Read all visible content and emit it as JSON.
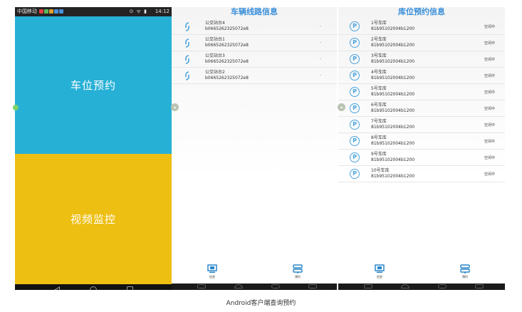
{
  "status_bar": {
    "carrier": "中国移动",
    "time": "14:12"
  },
  "home": {
    "parking_tile_label": "车位预约",
    "video_tile_label": "视频监控"
  },
  "routes_screen": {
    "title": "车辆线路信息",
    "items": [
      {
        "name": "公交站台4",
        "id": "b0665262325072e8",
        "value": "-"
      },
      {
        "name": "公交站台1",
        "id": "b0665262325072e8",
        "value": "-"
      },
      {
        "name": "公交站台3",
        "id": "b0665262325072e8",
        "value": "-"
      },
      {
        "name": "公交站台2",
        "id": "b0665262325072e8",
        "value": "-"
      }
    ],
    "tabs": [
      {
        "label": "信息",
        "icon": "monitor-icon"
      },
      {
        "label": "预约",
        "icon": "signpost-icon"
      }
    ]
  },
  "garage_screen": {
    "title": "库位预约信息",
    "items": [
      {
        "name": "1号车库",
        "id": "81b95102004b1200",
        "status": "空闲中"
      },
      {
        "name": "2号车库",
        "id": "81b95102004b1200",
        "status": "空闲中"
      },
      {
        "name": "3号车库",
        "id": "81b95102004b1200",
        "status": "空闲中"
      },
      {
        "name": "4号车库",
        "id": "81b95102004b1200",
        "status": "空闲中"
      },
      {
        "name": "5号车库",
        "id": "81b95102004b1200",
        "status": "空闲中"
      },
      {
        "name": "6号车库",
        "id": "81b95102004b1200",
        "status": "空闲中"
      },
      {
        "name": "7号车库",
        "id": "81b95102004b1200",
        "status": "空闲中"
      },
      {
        "name": "8号车库",
        "id": "81b95102004b1200",
        "status": "空闲中"
      },
      {
        "name": "9号车库",
        "id": "81b95102004b1200",
        "status": "空闲中"
      },
      {
        "name": "10号车库",
        "id": "81b95102004b1200",
        "status": "空闲中"
      }
    ],
    "tabs": [
      {
        "label": "信息",
        "icon": "monitor-icon"
      },
      {
        "label": "预约",
        "icon": "signpost-icon"
      }
    ]
  },
  "caption": "Android客户端查询预约",
  "colors": {
    "parking_tile": "#27b0d6",
    "video_tile": "#edbf13",
    "title_blue": "#3a8fd9",
    "icon_blue": "#4aa3df"
  }
}
